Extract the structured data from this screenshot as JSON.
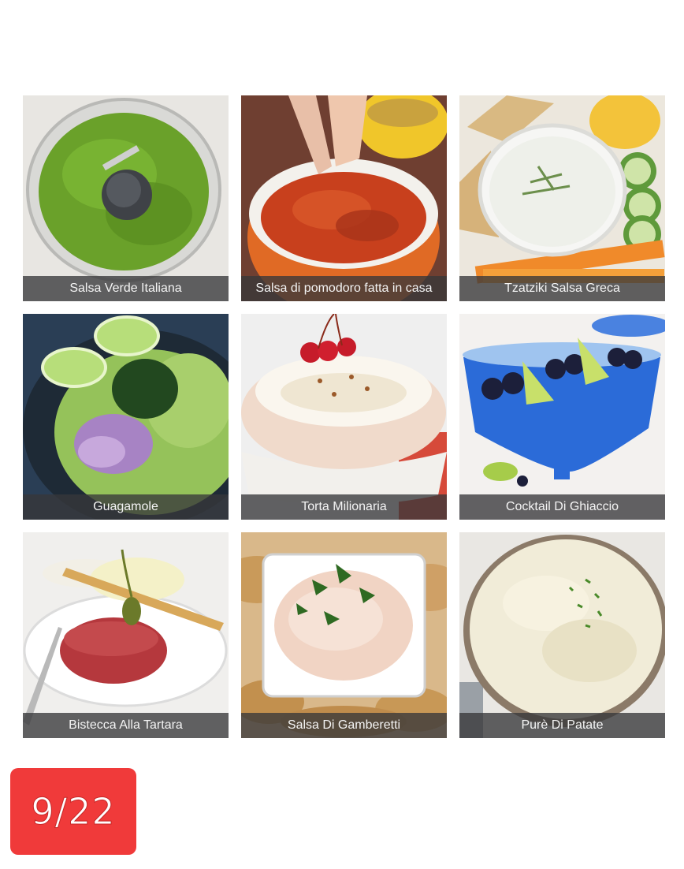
{
  "gallery": {
    "tiles": [
      {
        "label": "Salsa Verde Italiana"
      },
      {
        "label": "Salsa di pomodoro fatta in casa"
      },
      {
        "label": "Tzatziki Salsa Greca"
      },
      {
        "label": "Guagamole"
      },
      {
        "label": "Torta Milionaria"
      },
      {
        "label": "Cocktail Di Ghiaccio"
      },
      {
        "label": "Bistecca Alla Tartara"
      },
      {
        "label": "Salsa Di Gamberetti"
      },
      {
        "label": "Purè Di Patate"
      }
    ]
  },
  "pager": {
    "text": "9/22",
    "color": "#f03a3a"
  }
}
